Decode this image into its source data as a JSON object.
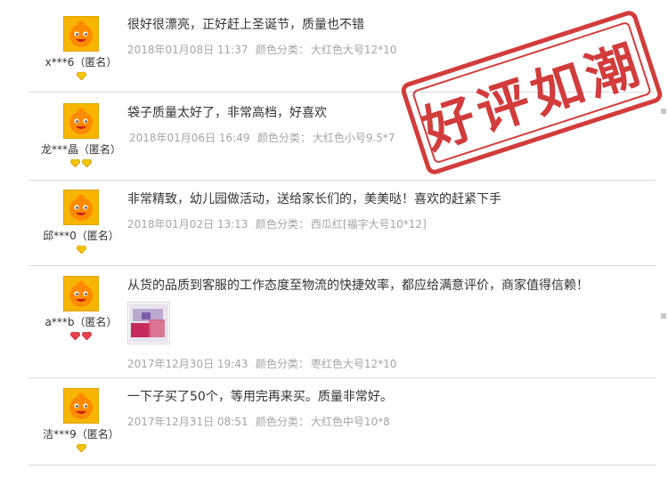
{
  "stamp": {
    "text": "好评如潮"
  },
  "spec_label": "颜色分类：",
  "reviews": [
    {
      "user": "x***6（匿名）",
      "badge_count": 1,
      "badge_color": "#f5c400",
      "text": "很好很漂亮，正好赶上圣诞节，质量也不错",
      "date": "2018年01月08日 11:37",
      "spec": "大红色大号12*10"
    },
    {
      "user": "龙***晶（匿名）",
      "badge_count": 2,
      "badge_color": "#f5c400",
      "text": "袋子质量太好了，非常高档，好喜欢",
      "date": "2018年01月06日 16:49",
      "spec": "大红色小号9.5*7"
    },
    {
      "user": "邱***0（匿名）",
      "badge_count": 1,
      "badge_color": "#f5c400",
      "text": "非常精致，幼儿园做活动，送给家长们的，美美哒！喜欢的赶紧下手",
      "date": "2018年01月02日 13:13",
      "spec": "西瓜红[福字大号10*12]"
    },
    {
      "user": "a***b（匿名）",
      "badge_count": 2,
      "badge_color": "#e8424f",
      "text": "从货的品质到客服的工作态度至物流的快捷效率，都应给满意评价，商家值得信赖！",
      "date": "2017年12月30日 19:43",
      "spec": "枣红色大号12*10"
    },
    {
      "user": "洁***9（匿名）",
      "badge_count": 1,
      "badge_color": "#f5c400",
      "text": "一下子买了50个，等用完再来买。质量非常好。",
      "date": "2017年12月31日 08:51",
      "spec": "大红色中号10*8"
    }
  ]
}
